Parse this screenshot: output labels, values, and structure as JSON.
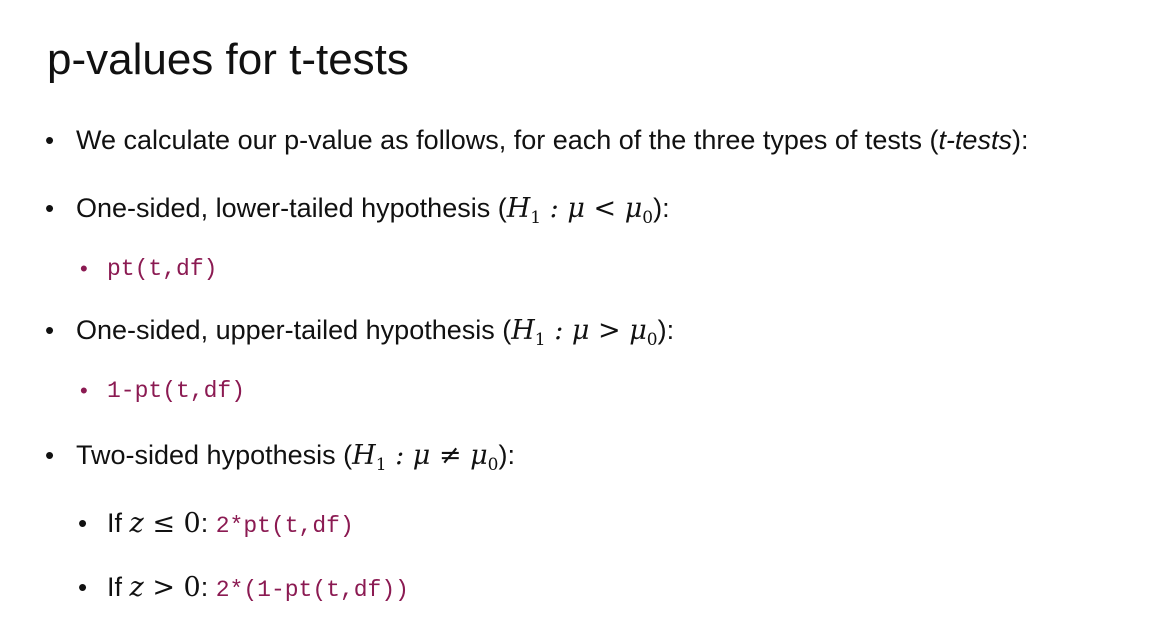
{
  "title": "p-values for t-tests",
  "bullets": {
    "b1": {
      "text_before": "We calculate our p-value as follows, for each of the three types of tests (",
      "emph": "t-tests",
      "text_after": "):"
    },
    "b2": {
      "text": "One-sided, lower-tailed hypothesis (",
      "H": "H",
      "H_sub": "1",
      "rel": " : μ < μ",
      "mu_sub": "0",
      "close": "):",
      "code": "pt(t,df)"
    },
    "b3": {
      "text": "One-sided, upper-tailed hypothesis (",
      "H": "H",
      "H_sub": "1",
      "rel": " : μ > μ",
      "mu_sub": "0",
      "close": "):",
      "code": "1-pt(t,df)"
    },
    "b4": {
      "text": "Two-sided hypothesis (",
      "H": "H",
      "H_sub": "1",
      "rel": " : μ ≠ μ",
      "mu_sub": "0",
      "close": "):",
      "sub1": {
        "lead": "If ",
        "var": "z",
        "cond": " ≤ 0",
        "colon": ": ",
        "code": "2*pt(t,df)"
      },
      "sub2": {
        "lead": "If ",
        "var": "z",
        "cond": " > 0",
        "colon": ": ",
        "code": "2*(1-pt(t,df))"
      }
    }
  }
}
